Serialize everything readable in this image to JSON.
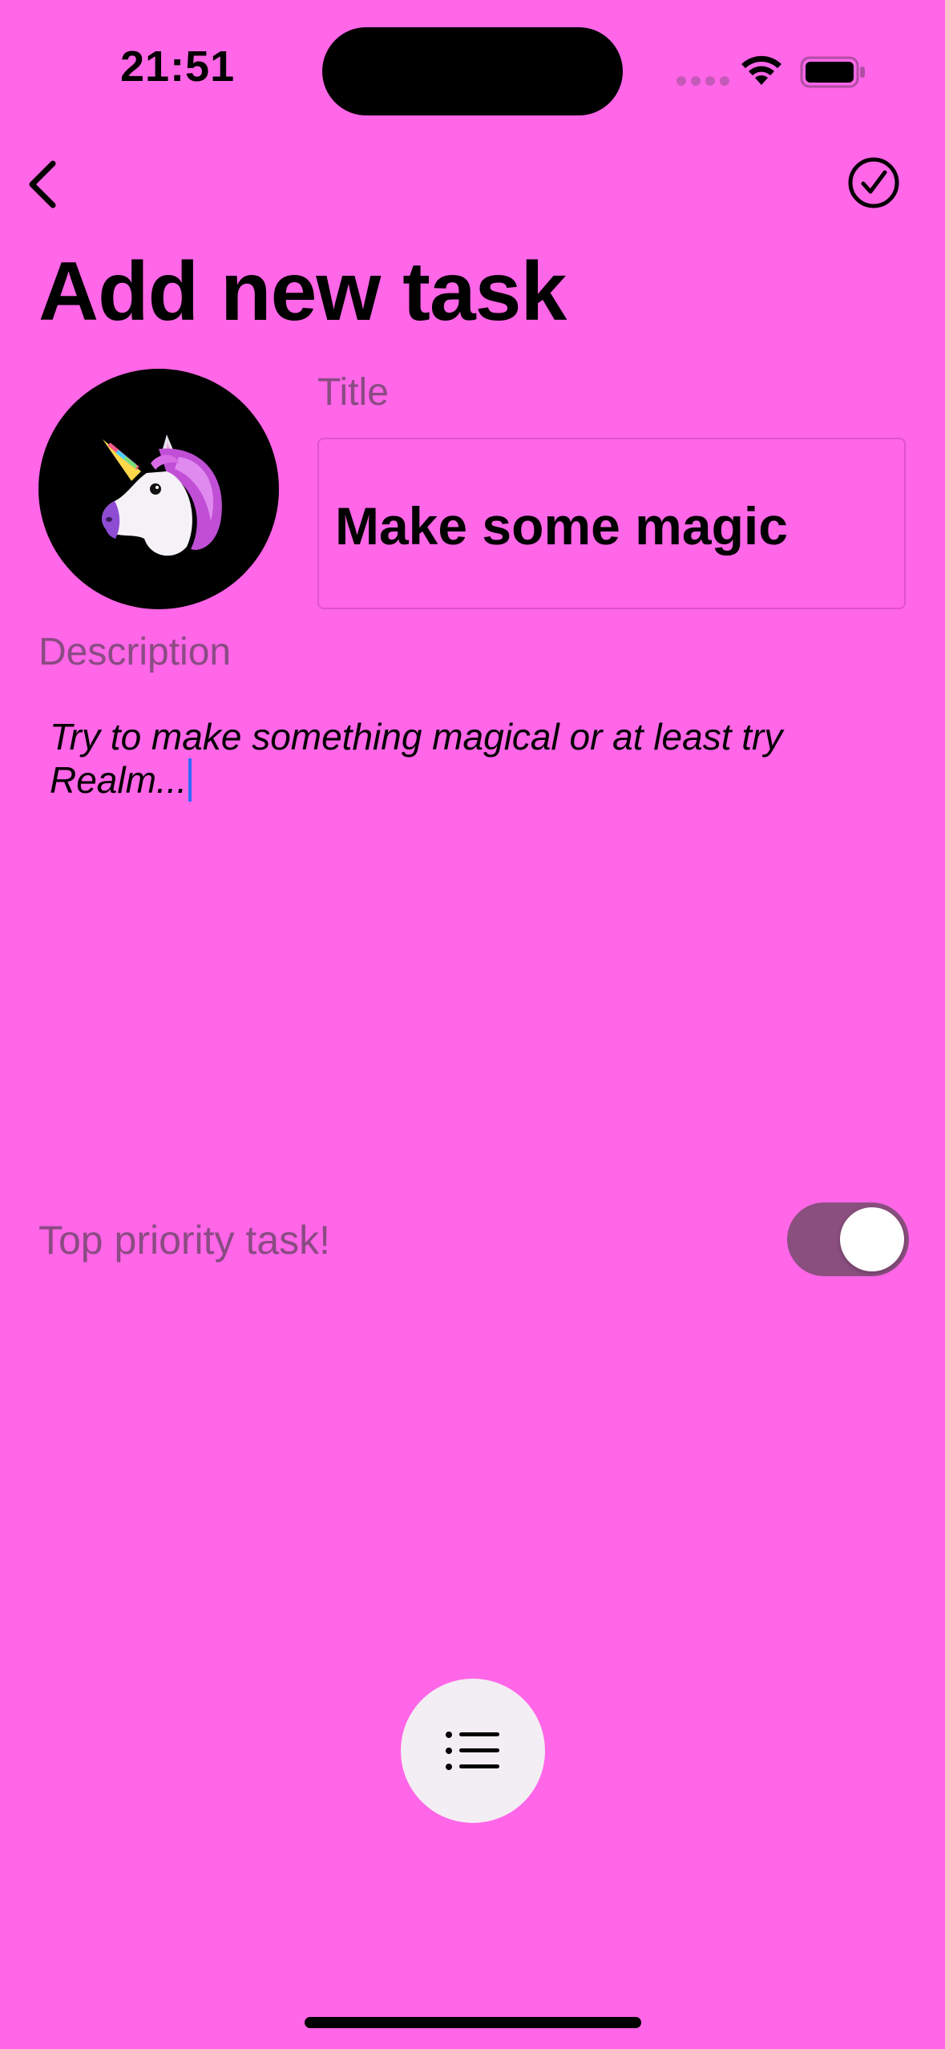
{
  "status_bar": {
    "time": "21:51",
    "icons": [
      "signal-icon",
      "wifi-icon",
      "battery-icon"
    ]
  },
  "nav": {
    "back_icon": "chevron-left-icon",
    "done_icon": "checkmark-circle-icon"
  },
  "page": {
    "title": "Add new task"
  },
  "avatar": {
    "icon": "unicorn-icon"
  },
  "form": {
    "title_label": "Title",
    "title_value": "Make some magic",
    "description_label": "Description",
    "description_value": "Try to make something magical or at least try Realm...",
    "priority_label": "Top priority task!",
    "priority_on": true
  },
  "bottom": {
    "list_icon": "list-icon"
  },
  "colors": {
    "background": "#ff66e8",
    "label": "#8a4b83",
    "toggle_on": "#8a4f7f",
    "caret": "#2f6bff"
  }
}
